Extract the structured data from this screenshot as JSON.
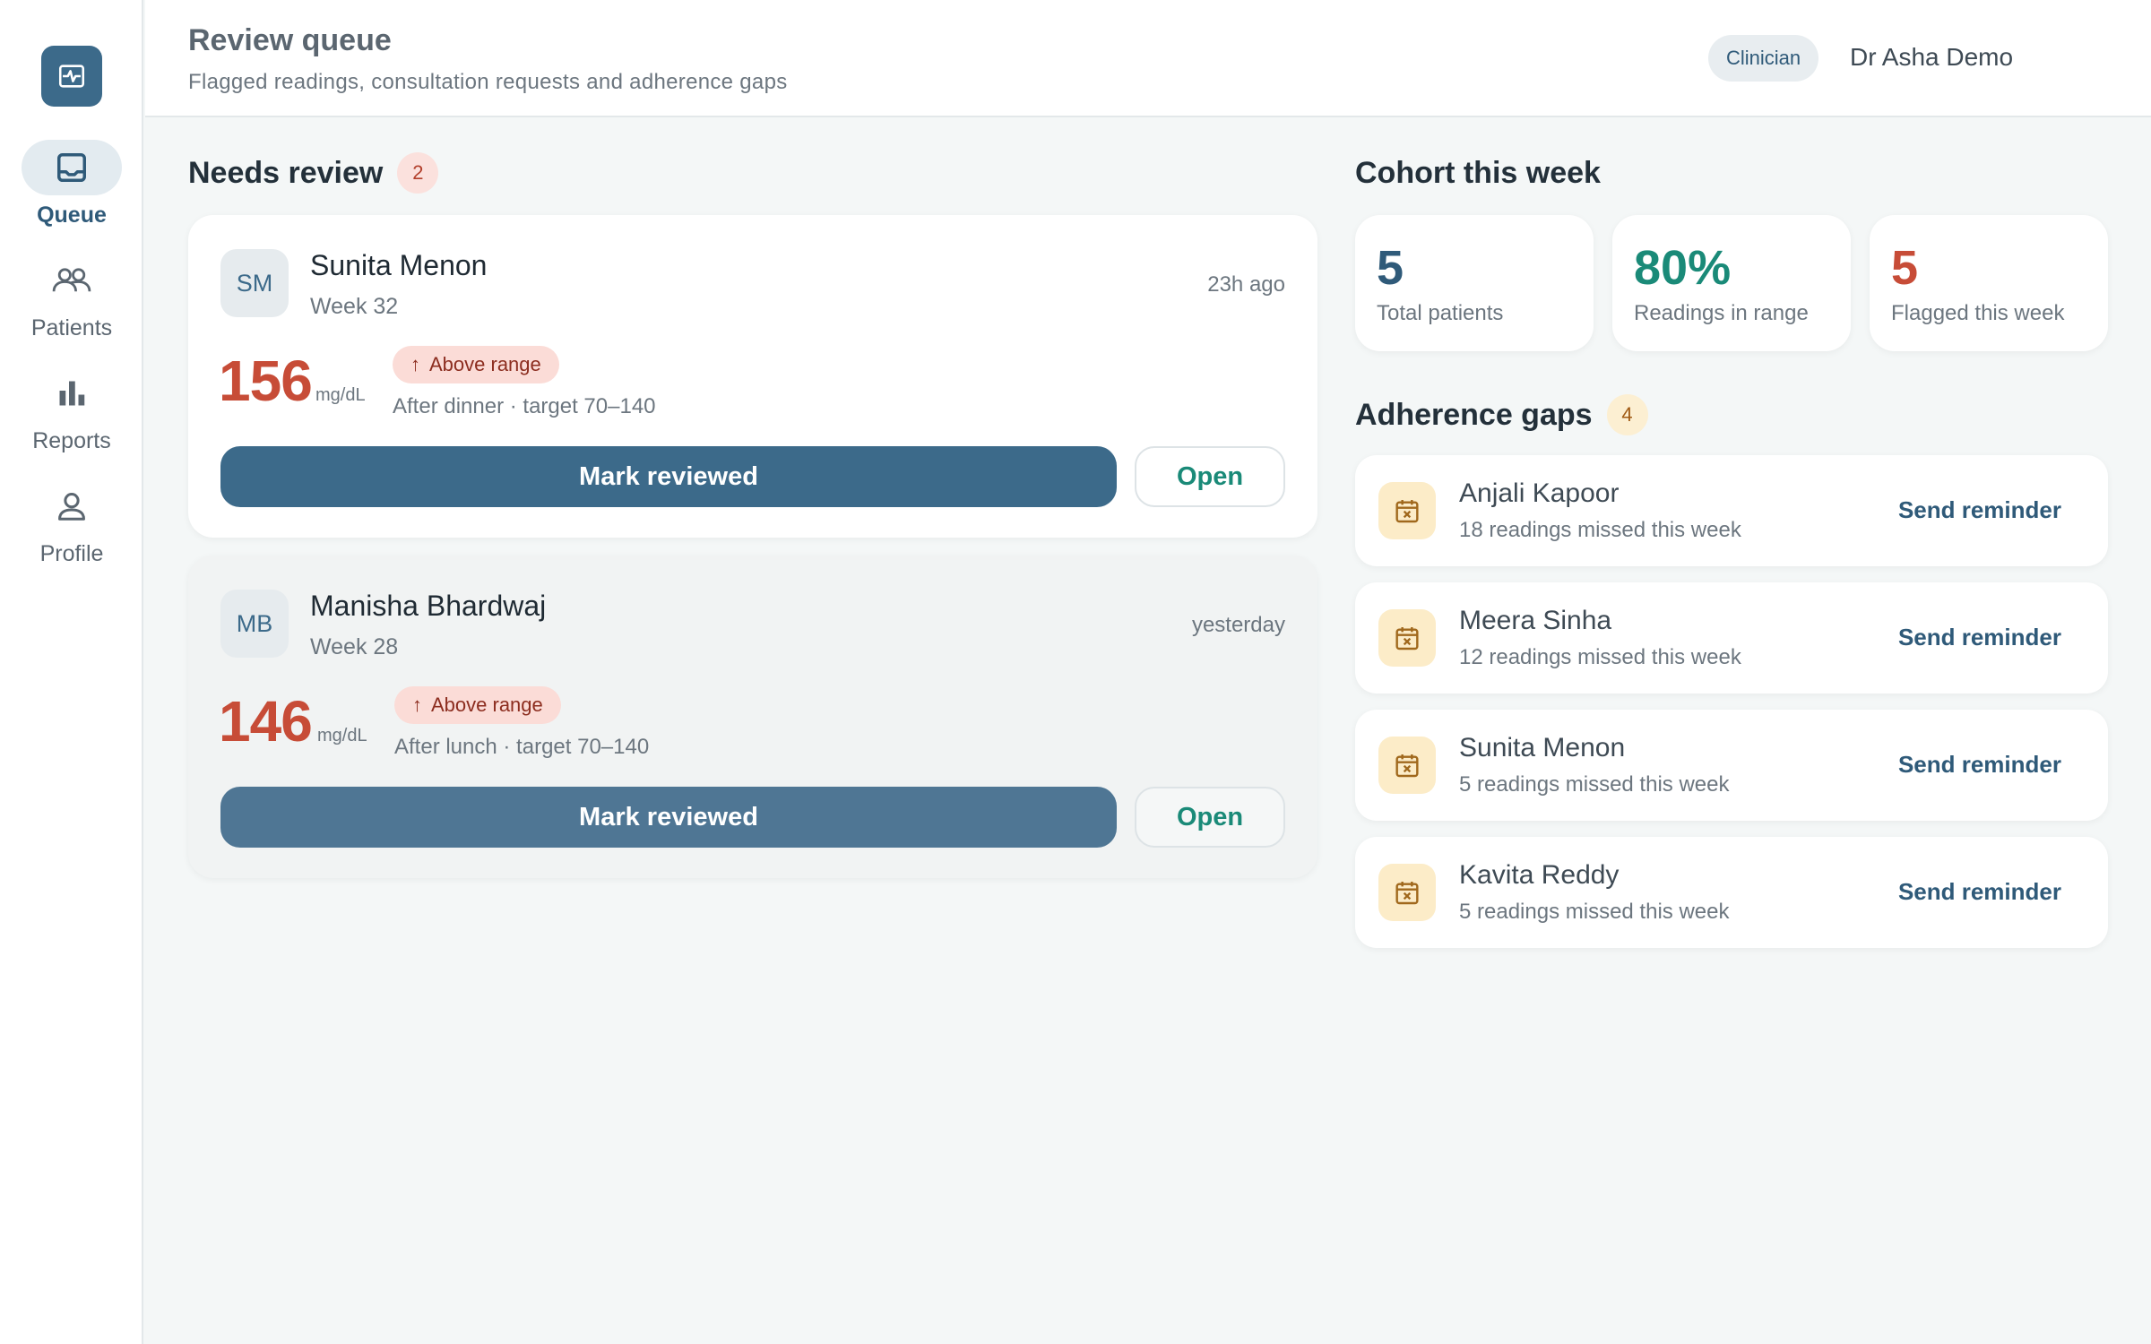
{
  "sidebar": {
    "items": [
      {
        "label": "Queue",
        "icon": "inbox-icon",
        "active": true
      },
      {
        "label": "Patients",
        "icon": "users-icon"
      },
      {
        "label": "Reports",
        "icon": "bar-chart-icon"
      },
      {
        "label": "Profile",
        "icon": "user-icon"
      }
    ]
  },
  "header": {
    "title": "Review queue",
    "subtitle": "Flagged readings, consultation requests and adherence gaps",
    "role": "Clinician",
    "user": "Dr Asha Demo"
  },
  "needs_review": {
    "title": "Needs review",
    "count": "2",
    "cards": [
      {
        "initials": "SM",
        "name": "Sunita Menon",
        "week": "Week 32",
        "time": "23h ago",
        "value": "156",
        "unit": "mg/dL",
        "status": "Above range",
        "note": "After dinner · target 70–140",
        "primary_action": "Mark reviewed",
        "secondary_action": "Open"
      },
      {
        "initials": "MB",
        "name": "Manisha Bhardwaj",
        "week": "Week 28",
        "time": "yesterday",
        "value": "146",
        "unit": "mg/dL",
        "status": "Above range",
        "note": "After lunch · target 70–140",
        "primary_action": "Mark reviewed",
        "secondary_action": "Open"
      }
    ]
  },
  "cohort": {
    "title": "Cohort this week",
    "stats": [
      {
        "value": "5",
        "label": "Total patients",
        "color": "#2f5a79"
      },
      {
        "value": "80%",
        "label": "Readings in range",
        "color": "#1a8a78"
      },
      {
        "value": "5",
        "label": "Flagged this week",
        "color": "#c74c37"
      }
    ]
  },
  "adherence": {
    "title": "Adherence gaps",
    "count": "4",
    "rows": [
      {
        "name": "Anjali Kapoor",
        "missed": "18 readings missed this week",
        "action": "Send reminder"
      },
      {
        "name": "Meera Sinha",
        "missed": "12 readings missed this week",
        "action": "Send reminder"
      },
      {
        "name": "Sunita Menon",
        "missed": "5 readings missed this week",
        "action": "Send reminder"
      },
      {
        "name": "Kavita Reddy",
        "missed": "5 readings missed this week",
        "action": "Send reminder"
      }
    ]
  },
  "colors": {
    "primary": "#3c6a8a",
    "accent_teal": "#1a8a78",
    "alert_red": "#c74c37",
    "warning_amber": "#fcecc8"
  }
}
